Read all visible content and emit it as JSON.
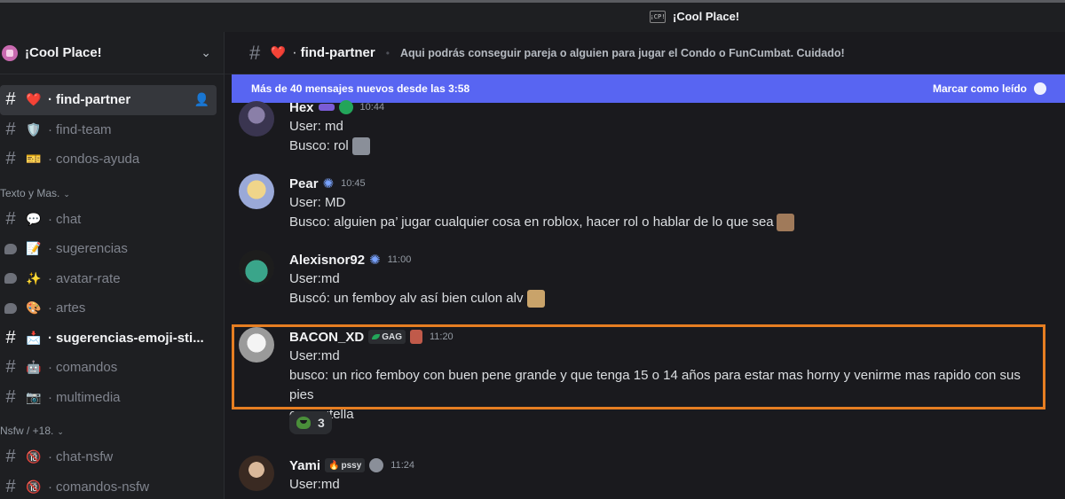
{
  "window": {
    "title": "¡Cool Place!",
    "icon_text": "¡CP!"
  },
  "server": {
    "name": "¡Cool Place!"
  },
  "channels_top": [
    {
      "label": "find-partner",
      "kind": "text",
      "emoji": "❤️",
      "active": true
    },
    {
      "label": "find-team",
      "kind": "text",
      "emoji": "🛡️"
    },
    {
      "label": "condos-ayuda",
      "kind": "text",
      "emoji": "🎫"
    }
  ],
  "categories": [
    {
      "name": "Texto y Mas.",
      "channels": [
        {
          "label": "chat",
          "kind": "text",
          "emoji": "💬"
        },
        {
          "label": "sugerencias",
          "kind": "forum",
          "emoji": "📝"
        },
        {
          "label": "avatar-rate",
          "kind": "forum",
          "emoji": "✨"
        },
        {
          "label": "artes",
          "kind": "forum",
          "emoji": "🎨"
        },
        {
          "label": "sugerencias-emoji-sti...",
          "kind": "text",
          "emoji": "📩",
          "unread": true
        },
        {
          "label": "comandos",
          "kind": "text",
          "emoji": "🤖"
        },
        {
          "label": "multimedia",
          "kind": "text",
          "emoji": "📷"
        }
      ]
    },
    {
      "name": "Nsfw / +18.",
      "channels": [
        {
          "label": "chat-nsfw",
          "kind": "text",
          "emoji": "🔞"
        },
        {
          "label": "comandos-nsfw",
          "kind": "text",
          "emoji": "🔞"
        }
      ]
    }
  ],
  "header": {
    "channel_name": "find-partner",
    "topic": "Aqui podrás conseguir pareja o alguien para jugar el Condo o FunCumbat. Cuidado!"
  },
  "new_messages_bar": {
    "text": "Más de 40 mensajes nuevos desde las 3:58",
    "action": "Marcar como leído"
  },
  "messages": [
    {
      "author": "Hex",
      "time": "10:44",
      "lines": [
        "User: md",
        "Busco: rol"
      ]
    },
    {
      "author": "Pear",
      "time": "10:45",
      "lines": [
        "User: MD",
        "Busco: alguien pa’ jugar cualquier cosa en roblox, hacer rol o hablar de lo que sea"
      ]
    },
    {
      "author": "Alexisnor92",
      "time": "11:00",
      "lines": [
        "User:md",
        "Buscó: un femboy alv así bien culon alv"
      ]
    },
    {
      "author": "BACON_XD",
      "time": "11:20",
      "badge": "GAG",
      "lines": [
        "User:md",
        "busco: un rico femboy con buen pene grande y que tenga 15 o 14 años para estar mas horny y venirme mas rapido con sus pies",
        "con nutella"
      ]
    },
    {
      "author": "Yami",
      "time": "11:24",
      "badge": "pssy",
      "lines": [
        "User:md"
      ]
    }
  ],
  "reaction": {
    "count": "3"
  },
  "colors": {
    "accent": "#5865f2",
    "highlight": "#e67e22",
    "bg": "#1a1a1e",
    "sidebar": "#1e1f22"
  }
}
